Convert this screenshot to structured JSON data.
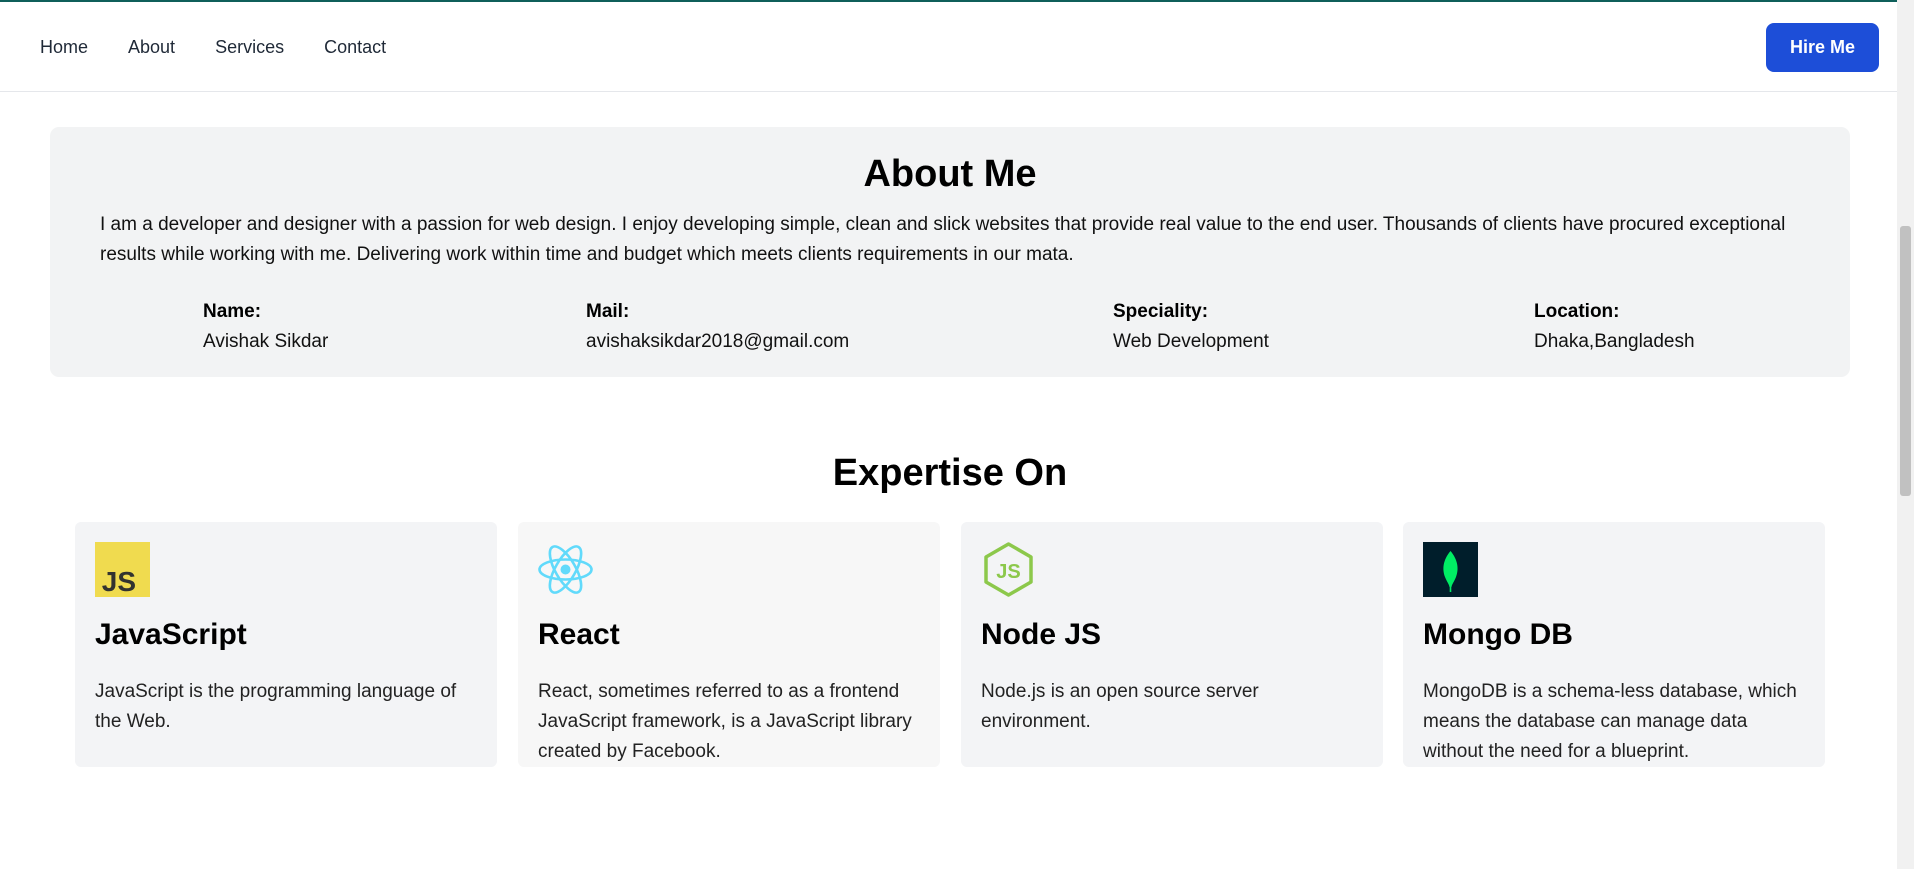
{
  "nav": {
    "links": [
      "Home",
      "About",
      "Services",
      "Contact"
    ],
    "hire_label": "Hire Me"
  },
  "about": {
    "title": "About Me",
    "text": "I am a developer and designer with a passion for web design. I enjoy developing simple, clean and slick websites that provide real value to the end user. Thousands of clients have procured exceptional results while working with me. Delivering work within time and budget which meets clients requirements in our mata.",
    "info": [
      {
        "label": "Name:",
        "value": "Avishak Sikdar"
      },
      {
        "label": "Mail:",
        "value": "avishaksikdar2018@gmail.com"
      },
      {
        "label": "Speciality:",
        "value": "Web Development"
      },
      {
        "label": "Location:",
        "value": "Dhaka,Bangladesh"
      }
    ]
  },
  "expertise": {
    "title": "Expertise On",
    "cards": [
      {
        "title": "JavaScript",
        "icon": "javascript-icon",
        "desc": "JavaScript is the programming language of the Web."
      },
      {
        "title": "React",
        "icon": "react-icon",
        "desc": "React, sometimes referred to as a frontend JavaScript framework, is a JavaScript library created by Facebook."
      },
      {
        "title": "Node JS",
        "icon": "nodejs-icon",
        "desc": "Node.js is an open source server environment."
      },
      {
        "title": "Mongo DB",
        "icon": "mongodb-icon",
        "desc": "MongoDB is a schema-less database, which means the database can manage data without the need for a blueprint."
      }
    ]
  },
  "colors": {
    "accent": "#1d4ed8",
    "section_bg": "#f2f3f4",
    "js_yellow": "#f0db4f",
    "react_blue": "#61dafb",
    "node_green": "#8cc84b",
    "mongo_dark": "#001e2b",
    "mongo_green": "#00ed64"
  }
}
